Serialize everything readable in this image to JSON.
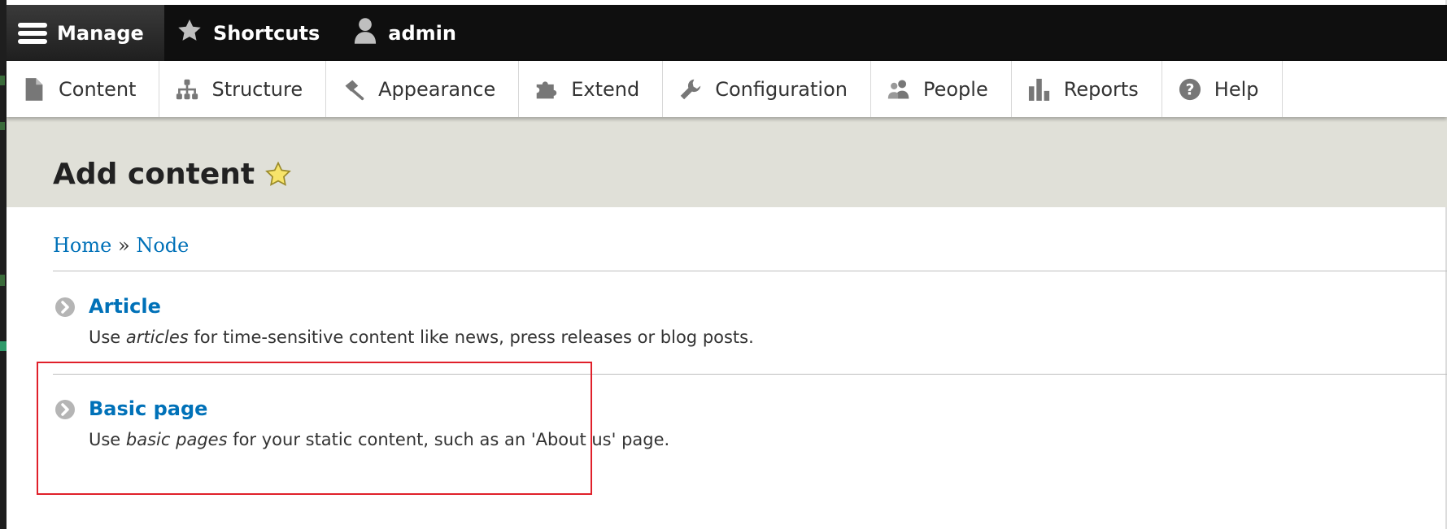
{
  "toolbar": {
    "manage_label": "Manage",
    "shortcuts_label": "Shortcuts",
    "user_label": "admin"
  },
  "tray": {
    "items": [
      {
        "label": "Content",
        "icon": "file-icon"
      },
      {
        "label": "Structure",
        "icon": "sitemap-icon"
      },
      {
        "label": "Appearance",
        "icon": "paintbrush-icon"
      },
      {
        "label": "Extend",
        "icon": "puzzle-icon"
      },
      {
        "label": "Configuration",
        "icon": "wrench-icon"
      },
      {
        "label": "People",
        "icon": "people-icon"
      },
      {
        "label": "Reports",
        "icon": "bar-chart-icon"
      },
      {
        "label": "Help",
        "icon": "help-icon"
      }
    ]
  },
  "page": {
    "title": "Add content"
  },
  "breadcrumb": {
    "home": "Home",
    "separator": "»",
    "node": "Node"
  },
  "content_types": [
    {
      "title": "Article",
      "desc_before": "Use ",
      "desc_em": "articles",
      "desc_after": " for time-sensitive content like news, press releases or blog posts."
    },
    {
      "title": "Basic page",
      "desc_before": "Use ",
      "desc_em": "basic pages",
      "desc_after": " for your static content, such as an 'About us' page."
    }
  ],
  "colors": {
    "toolbar_bg": "#0f0f0f",
    "link": "#0071b8",
    "header_bg": "#e0e0d8",
    "highlight": "#e0202a"
  }
}
